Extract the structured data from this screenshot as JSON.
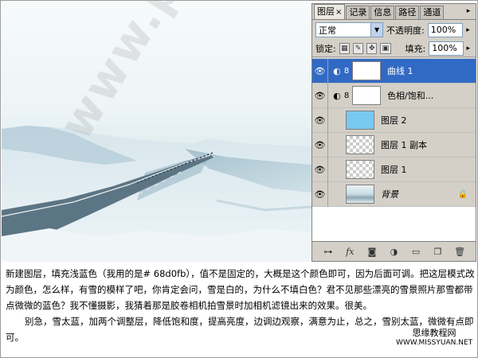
{
  "panel": {
    "tabs": [
      {
        "label": "图层",
        "close": "×",
        "active": true
      },
      {
        "label": "记录"
      },
      {
        "label": "信息"
      },
      {
        "label": "路径"
      },
      {
        "label": "通道"
      }
    ],
    "menu_arrow": "▸",
    "blend_mode": "正常",
    "opacity_label": "不透明度:",
    "opacity_value": "100%",
    "lock_label": "锁定:",
    "fill_label": "填充:",
    "fill_value": "100%",
    "layers": [
      {
        "name": "曲线 1",
        "type": "adjustment",
        "selected": true
      },
      {
        "name": "色相/饱和...",
        "type": "adjustment"
      },
      {
        "name": "图层 2",
        "type": "fill-blue"
      },
      {
        "name": "图层 1 副本",
        "type": "transparent"
      },
      {
        "name": "图层 1",
        "type": "transparent"
      },
      {
        "name": "背景",
        "type": "photo",
        "locked": true
      }
    ],
    "bottom_icons": [
      "link-icon",
      "fx-icon",
      "mask-icon",
      "adjustment-icon",
      "folder-icon",
      "new-layer-icon",
      "trash-icon"
    ]
  },
  "text": {
    "paragraph1": "新建图层，填充浅蓝色（我用的是# 68d0fb），值不是固定的，大概是这个颜色即可，因为后面可调。把这层模式改为颜色，怎么样，有雪的模样了吧，你肯定会问，雪是白的，为什么不填白色？君不见那些漂亮的雪景照片那雪都带点微微的蓝色？我不懂摄影，我猜着那是胶卷相机拍雪景时加相机滤镜出来的效果。很美。",
    "paragraph2": "别急，雪太蓝，加两个调整层，降低饱和度，提高亮度，边调边观察，满意为止，总之，雪别太蓝，微微有点即可。"
  },
  "signature": {
    "name": "思缘教程网",
    "url": "WWW.MISSYUAN.NET"
  },
  "watermark": "www.ps2009.com",
  "colors": {
    "selected_layer": "#316ac5",
    "layer2_fill": "#78c8f0"
  }
}
